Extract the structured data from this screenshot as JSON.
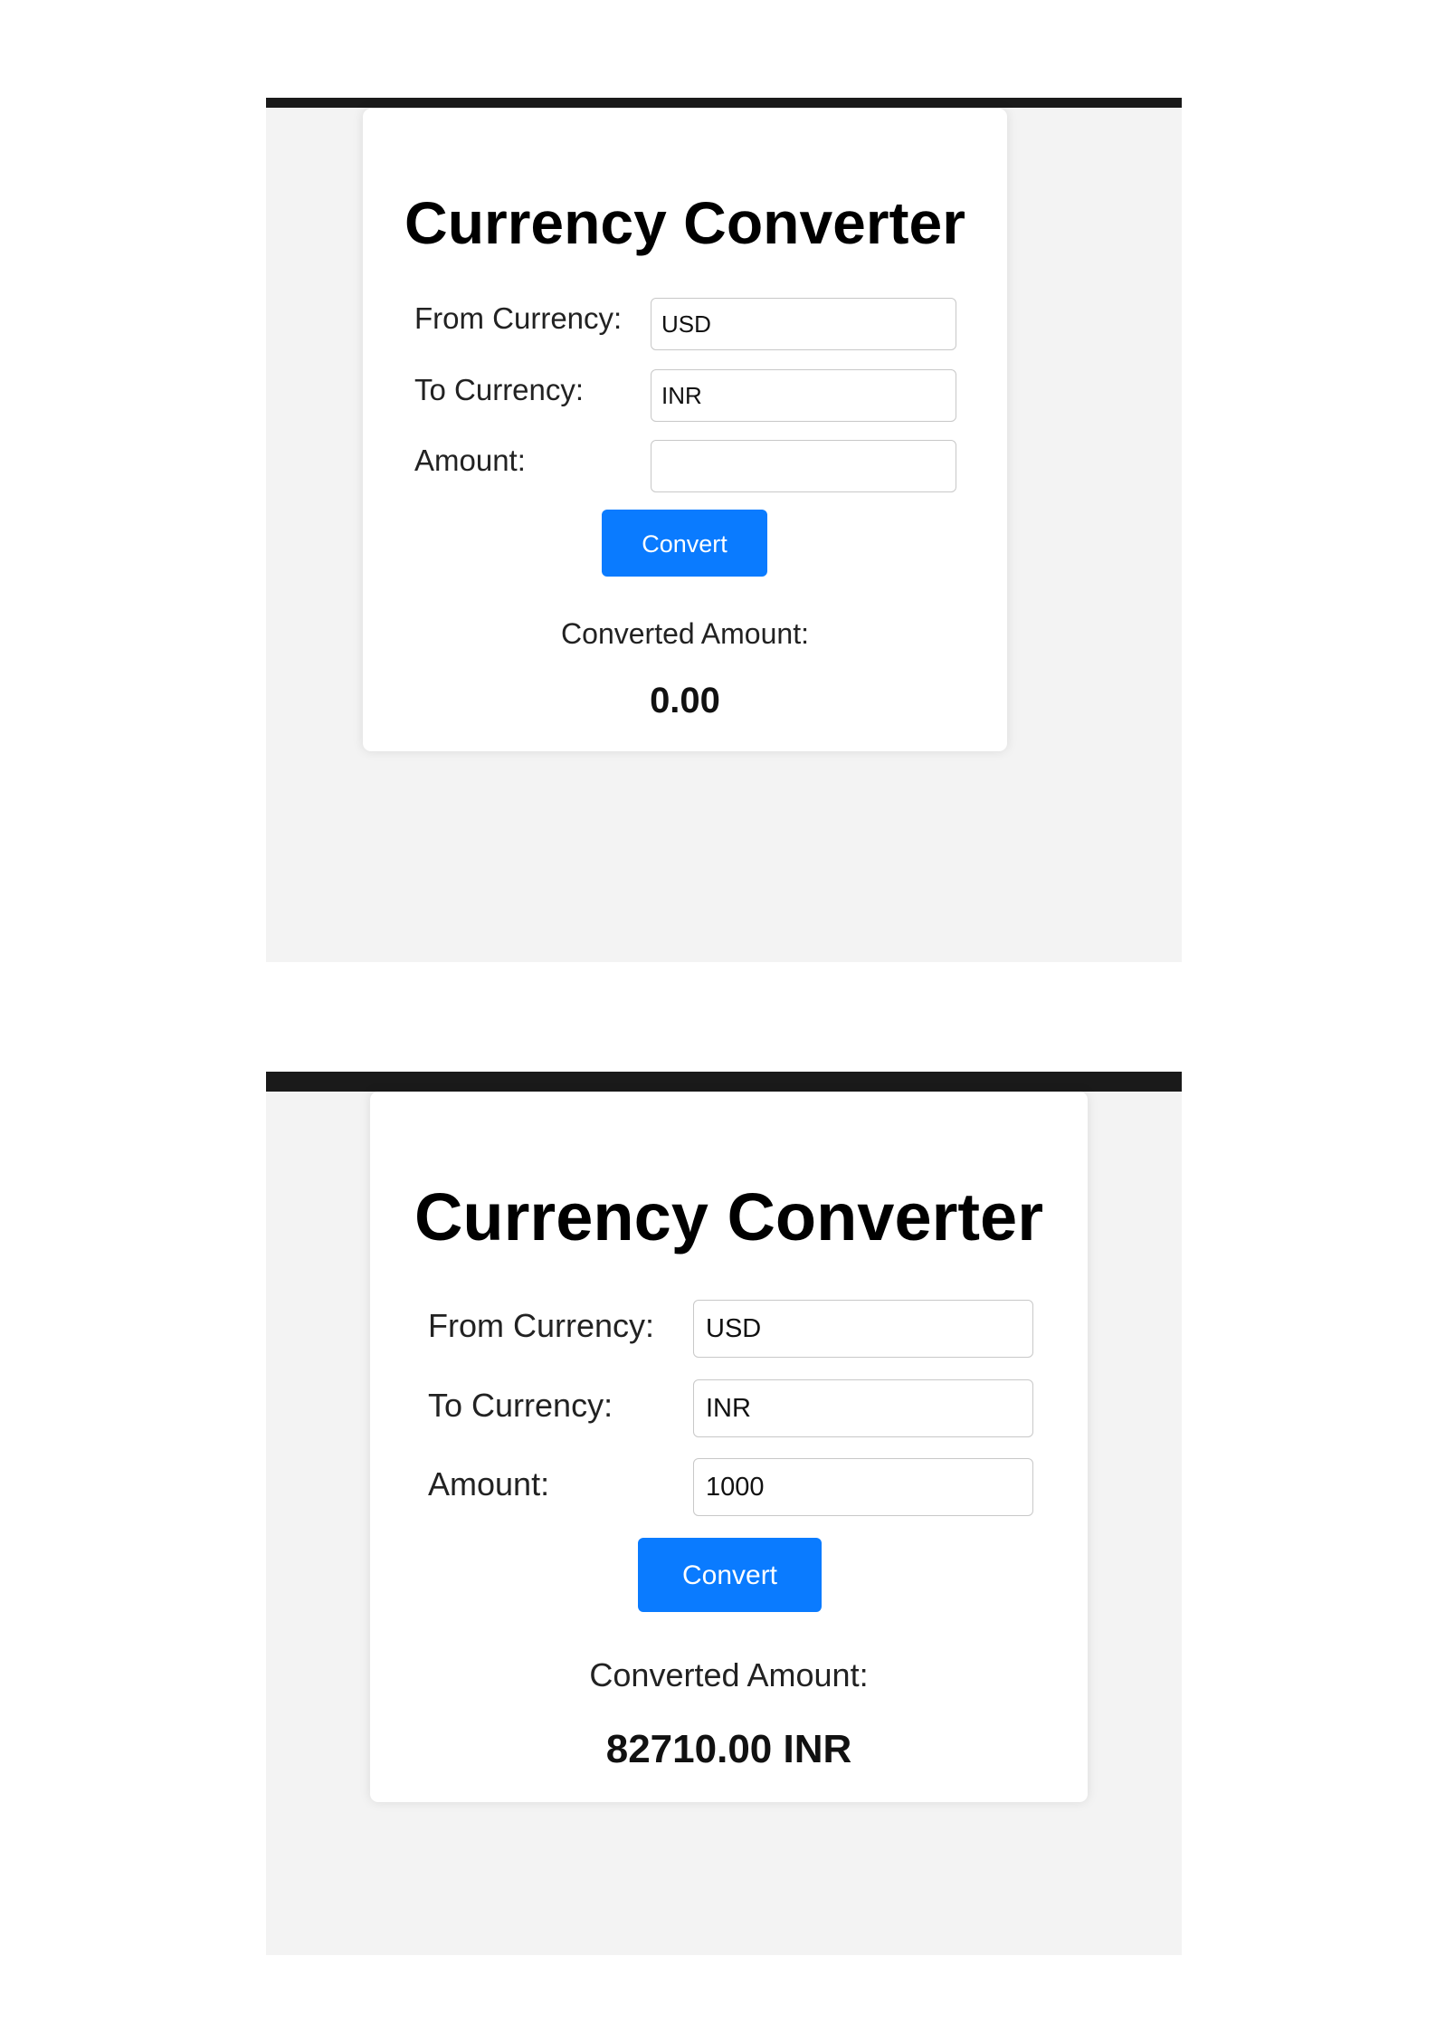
{
  "colors": {
    "accent": "#0a7bff",
    "page_background": "#f3f3f3",
    "card_background": "#ffffff",
    "topbar": "#1a1a1a"
  },
  "panels": [
    {
      "title": "Currency Converter",
      "from_label": "From Currency:",
      "from_value": "USD",
      "to_label": "To Currency:",
      "to_value": "INR",
      "amount_label": "Amount:",
      "amount_value": "",
      "convert_label": "Convert",
      "result_label": "Converted Amount:",
      "result_value": "0.00"
    },
    {
      "title": "Currency Converter",
      "from_label": "From Currency:",
      "from_value": "USD",
      "to_label": "To Currency:",
      "to_value": "INR",
      "amount_label": "Amount:",
      "amount_value": "1000",
      "convert_label": "Convert",
      "result_label": "Converted Amount:",
      "result_value": "82710.00 INR"
    }
  ]
}
